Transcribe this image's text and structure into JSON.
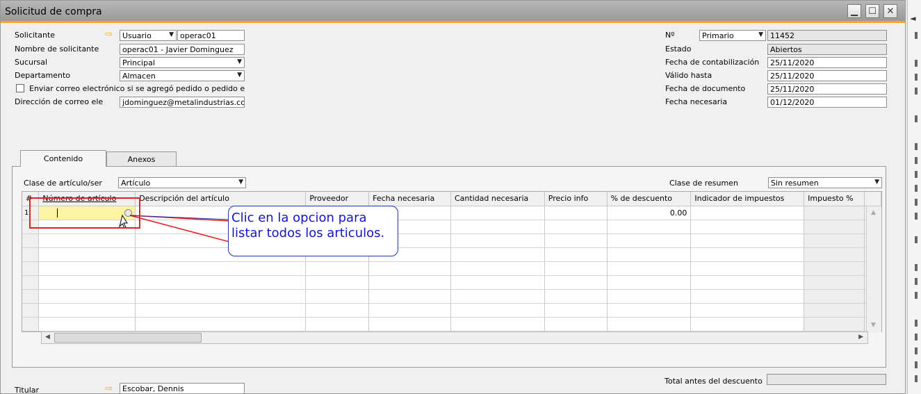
{
  "window": {
    "title": "Solicitud de compra"
  },
  "header": {
    "solicitante_label": "Solicitante",
    "solicitante_type": "Usuario",
    "solicitante_code": "operac01",
    "nombre_label": "Nombre de solicitante",
    "nombre_value": "operac01 - Javier Dominguez",
    "sucursal_label": "Sucursal",
    "sucursal_value": "Principal",
    "departamento_label": "Departamento",
    "departamento_value": "Almacen",
    "email_checkbox_label": "Enviar correo electrónico si se agregó pedido o pedido e",
    "email_label": "Dirección de correo ele",
    "email_value": "jdominguez@metalindustrias.co",
    "no_label": "Nº",
    "series_value": "Primario",
    "doc_number": "11452",
    "estado_label": "Estado",
    "estado_value": "Abiertos",
    "fecha_contab_label": "Fecha de contabilización",
    "fecha_contab_value": "25/11/2020",
    "valido_label": "Válido hasta",
    "valido_value": "25/11/2020",
    "fecha_doc_label": "Fecha de documento",
    "fecha_doc_value": "25/11/2020",
    "fecha_nec_label": "Fecha necesaria",
    "fecha_nec_value": "01/12/2020"
  },
  "tabs": [
    {
      "label": "Contenido"
    },
    {
      "label": "Anexos"
    }
  ],
  "contenido": {
    "clase_label": "Clase de artículo/ser",
    "clase_value": "Artículo",
    "resumen_label": "Clase de resumen",
    "resumen_value": "Sin resumen",
    "columns": [
      "#",
      "Número de artículo",
      "Descripción del artículo",
      "Proveedor",
      "Fecha necesaria",
      "Cantidad necesaria",
      "Precio info",
      "% de descuento",
      "Indicador de impuestos",
      "Impuesto %"
    ],
    "row1_num": "1",
    "row1_discount": "0.00"
  },
  "callout": {
    "line1": "Clic en la opcion para",
    "line2": "listar todos los articulos."
  },
  "footer": {
    "titular_label": "Titular",
    "titular_value": "Escobar, Dennis",
    "total_label": "Total antes del descuento"
  },
  "colors": {
    "accent": "#f5a623",
    "highlight_cell": "#fdf3a0",
    "callout_text": "#1515c8",
    "red_box": "#e02020"
  }
}
